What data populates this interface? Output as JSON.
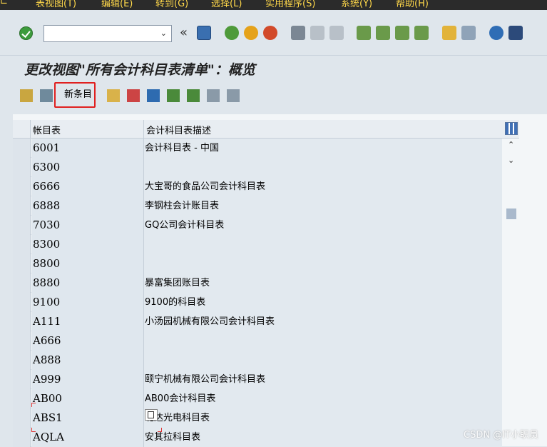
{
  "menu": {
    "items": [
      "表视图(T)",
      "编辑(E)",
      "转到(G)",
      "选择(L)",
      "实用程序(S)",
      "系统(Y)",
      "帮助(H)"
    ]
  },
  "system_toolbar": {
    "command_field_value": "",
    "icons": [
      "enter-icon",
      "save-icon",
      "back-icon",
      "exit-icon",
      "cancel-icon",
      "print-icon",
      "find-icon",
      "find-next-icon",
      "first-page-icon",
      "prev-page-icon",
      "next-page-icon",
      "last-page-icon",
      "new-session-icon",
      "shortcut-icon",
      "help-icon",
      "customize-icon"
    ]
  },
  "title": "更改视图\"所有会计科目表清单\"：概览",
  "app_toolbar": {
    "new_entries_label": "新条目",
    "icons": [
      "display-change-icon",
      "display-icon",
      "copy-as-icon",
      "delete-icon",
      "undo-icon",
      "select-all-icon",
      "select-block-icon",
      "deselect-all-icon",
      "config-icon"
    ]
  },
  "table": {
    "columns": [
      "帐目表",
      "会计科目表描述"
    ],
    "rows": [
      {
        "code": "6001",
        "desc": "会计科目表 - 中国"
      },
      {
        "code": "6300",
        "desc": ""
      },
      {
        "code": "6666",
        "desc": "大宝哥的食品公司会计科目表"
      },
      {
        "code": "6888",
        "desc": "李钢柱会计账目表"
      },
      {
        "code": "7030",
        "desc": "GQ公司会计科目表"
      },
      {
        "code": "8300",
        "desc": ""
      },
      {
        "code": "8800",
        "desc": ""
      },
      {
        "code": "8880",
        "desc": "暴富集团账目表"
      },
      {
        "code": "9100",
        "desc": "9100的科目表"
      },
      {
        "code": "A111",
        "desc": "小汤园机械有限公司会计科目表"
      },
      {
        "code": "A666",
        "desc": ""
      },
      {
        "code": "A888",
        "desc": ""
      },
      {
        "code": "A999",
        "desc": "颐宁机械有限公司会计科目表"
      },
      {
        "code": "AB00",
        "desc": "AB00会计科目表"
      },
      {
        "code": "ABS1",
        "desc": "北达光电科目表"
      },
      {
        "code": "AQLA",
        "desc": "安其拉科目表"
      }
    ]
  },
  "watermark": "CSDN @IT小职员",
  "colors": {
    "highlight": "#e02020",
    "ok_green": "#3d9b3d"
  }
}
